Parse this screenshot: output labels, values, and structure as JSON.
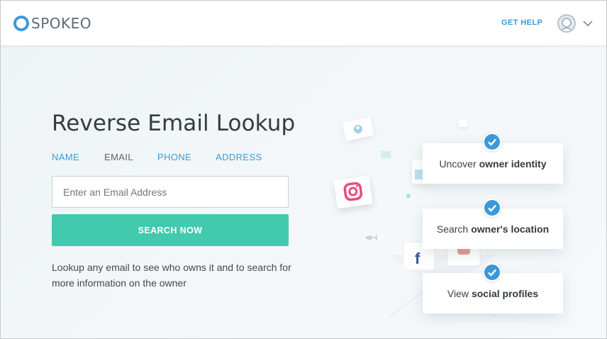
{
  "header": {
    "brand": "SPOKEO",
    "get_help": "GET HELP"
  },
  "main": {
    "title": "Reverse Email Lookup",
    "tabs": [
      {
        "label": "NAME",
        "active": false
      },
      {
        "label": "EMAIL",
        "active": true
      },
      {
        "label": "PHONE",
        "active": false
      },
      {
        "label": "ADDRESS",
        "active": false
      }
    ],
    "search": {
      "placeholder": "Enter an Email Address",
      "value": "",
      "button_label": "SEARCH NOW"
    },
    "description": "Lookup any email to see who owns it and to search for more information on the owner"
  },
  "features": [
    {
      "prefix": "Uncover",
      "bold": "owner identity"
    },
    {
      "prefix": "Search",
      "bold": "owner's location"
    },
    {
      "prefix": "View",
      "bold": "social profiles"
    }
  ],
  "colors": {
    "accent_blue": "#3a9ad9",
    "button_green": "#43c9ad",
    "title_text": "#333b41"
  },
  "icons": [
    "spokeo-logo-icon",
    "avatar-icon",
    "chevron-down-icon",
    "check-icon",
    "instagram-icon",
    "facebook-icon",
    "envelope-icon"
  ]
}
